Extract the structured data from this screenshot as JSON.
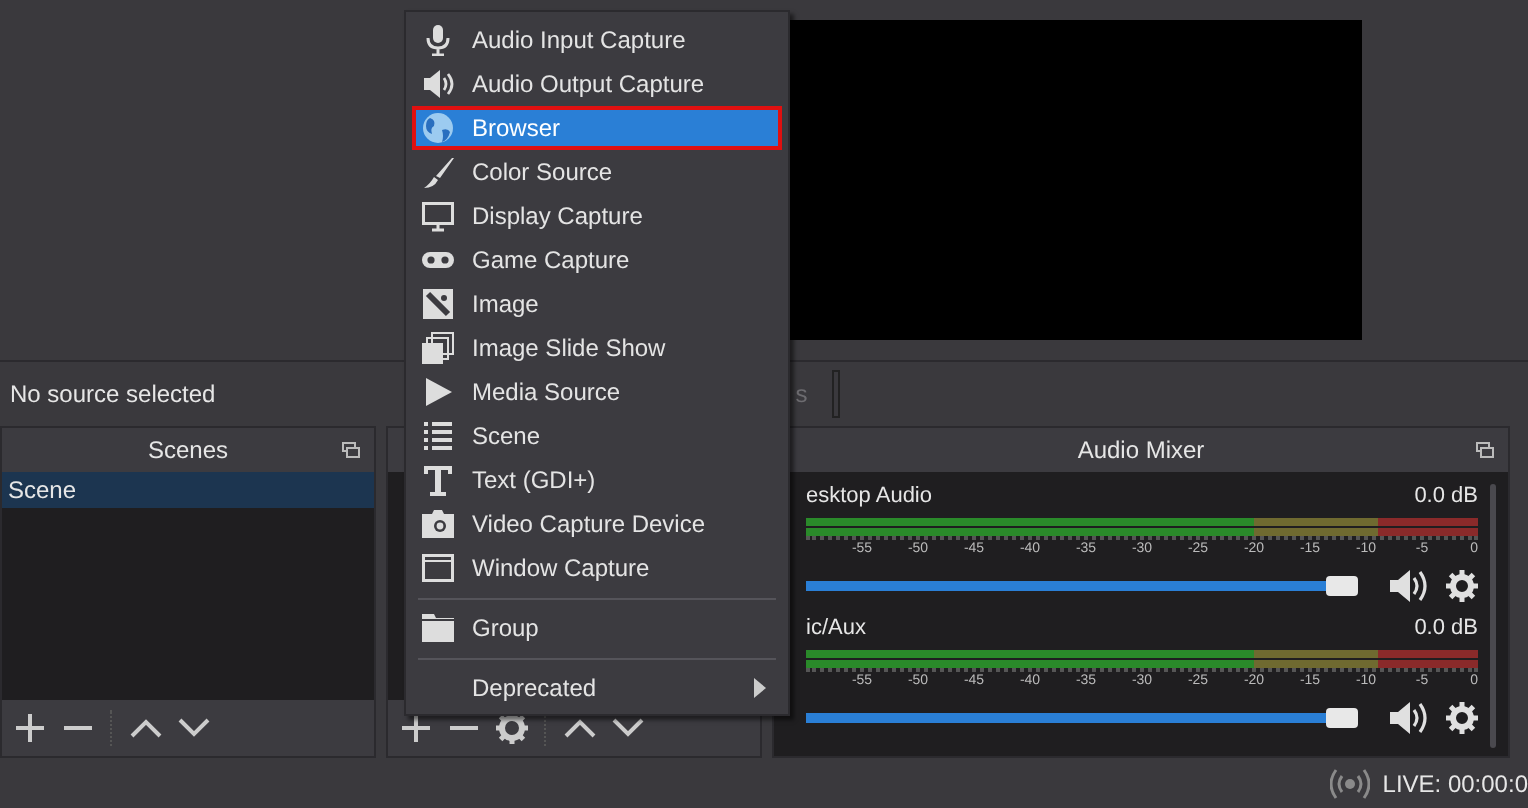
{
  "source_bar": {
    "label": "No source selected",
    "button_tail": "s"
  },
  "scenes_dock": {
    "title": "Scenes",
    "items": [
      {
        "label": "Scene",
        "selected": true
      }
    ]
  },
  "audio_mixer": {
    "title": "Audio Mixer",
    "channels": [
      {
        "name": "esktop Audio",
        "reading": "0.0 dB",
        "level": 1,
        "muted": false,
        "scale": [
          "-55",
          "-50",
          "-45",
          "-40",
          "-35",
          "-30",
          "-25",
          "-20",
          "-15",
          "-10",
          "-5",
          "0"
        ]
      },
      {
        "name": "ic/Aux",
        "reading": "0.0 dB",
        "level": 1,
        "muted": false,
        "scale": [
          "-55",
          "-50",
          "-45",
          "-40",
          "-35",
          "-30",
          "-25",
          "-20",
          "-15",
          "-10",
          "-5",
          "0"
        ]
      }
    ]
  },
  "context_menu": {
    "items": [
      {
        "kind": "item",
        "label": "Audio Input Capture",
        "selected": false,
        "highlighted": false
      },
      {
        "kind": "item",
        "label": "Audio Output Capture",
        "selected": false,
        "highlighted": false
      },
      {
        "kind": "item",
        "label": "Browser",
        "selected": true,
        "highlighted": true
      },
      {
        "kind": "item",
        "label": "Color Source",
        "selected": false,
        "highlighted": false
      },
      {
        "kind": "item",
        "label": "Display Capture",
        "selected": false,
        "highlighted": false
      },
      {
        "kind": "item",
        "label": "Game Capture",
        "selected": false,
        "highlighted": false
      },
      {
        "kind": "item",
        "label": "Image",
        "selected": false,
        "highlighted": false
      },
      {
        "kind": "item",
        "label": "Image Slide Show",
        "selected": false,
        "highlighted": false
      },
      {
        "kind": "item",
        "label": "Media Source",
        "selected": false,
        "highlighted": false
      },
      {
        "kind": "item",
        "label": "Scene",
        "selected": false,
        "highlighted": false
      },
      {
        "kind": "item",
        "label": "Text (GDI+)",
        "selected": false,
        "highlighted": false
      },
      {
        "kind": "item",
        "label": "Video Capture Device",
        "selected": false,
        "highlighted": false
      },
      {
        "kind": "item",
        "label": "Window Capture",
        "selected": false,
        "highlighted": false
      },
      {
        "kind": "separator"
      },
      {
        "kind": "item",
        "label": "Group",
        "selected": false,
        "highlighted": false
      },
      {
        "kind": "separator"
      },
      {
        "kind": "submenu",
        "label": "Deprecated",
        "selected": false,
        "highlighted": false
      }
    ]
  },
  "status_bar": {
    "live": "LIVE: 00:00:0"
  }
}
